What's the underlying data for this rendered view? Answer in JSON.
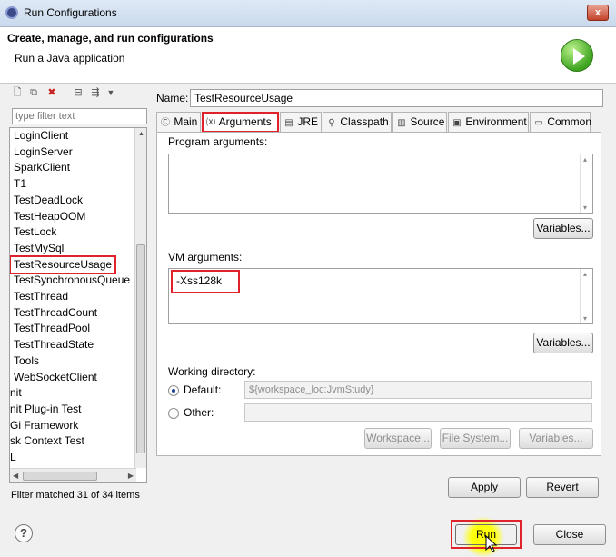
{
  "window": {
    "title": "Run Configurations",
    "close_glyph": "x"
  },
  "header": {
    "title": "Create, manage, and run configurations",
    "subtitle": "Run a Java application",
    "icon": "run-icon"
  },
  "left": {
    "toolbar_icons": [
      "new-launch-config-icon",
      "duplicate-icon",
      "delete-icon",
      "collapse-all-icon",
      "filter-icon",
      "chevron-down-icon"
    ],
    "filter_placeholder": "type filter text",
    "items": [
      "LoginClient",
      "LoginServer",
      "SparkClient",
      "T1",
      "TestDeadLock",
      "TestHeapOOM",
      "TestLock",
      "TestMySql",
      "TestResourceUsage",
      "TestSynchronousQueue",
      "TestThread",
      "TestThreadCount",
      "TestThreadPool",
      "TestThreadState",
      "Tools",
      "WebSocketClient",
      "nit",
      "nit Plug-in Test",
      "Gi Framework",
      "sk Context Test",
      "L"
    ],
    "selected_item": "TestResourceUsage",
    "filter_status": "Filter matched 31 of 34 items"
  },
  "right": {
    "name_label": "Name:",
    "name_value": "TestResourceUsage",
    "tabs": [
      {
        "label": "Main",
        "icon": "main-tab-icon"
      },
      {
        "label": "Arguments",
        "icon": "arguments-tab-icon"
      },
      {
        "label": "JRE",
        "icon": "jre-tab-icon"
      },
      {
        "label": "Classpath",
        "icon": "classpath-tab-icon"
      },
      {
        "label": "Source",
        "icon": "source-tab-icon"
      },
      {
        "label": "Environment",
        "icon": "environment-tab-icon"
      },
      {
        "label": "Common",
        "icon": "common-tab-icon"
      }
    ],
    "active_tab": "Arguments",
    "program_args_label": "Program arguments:",
    "program_args_value": "",
    "variables_label": "Variables...",
    "vm_args_label": "VM arguments:",
    "vm_args_value": "-Xss128k",
    "working_dir_label": "Working directory:",
    "default_label": "Default:",
    "default_value": "${workspace_loc:JvmStudy}",
    "other_label": "Other:",
    "other_value": "",
    "workspace_label": "Workspace...",
    "filesystem_label": "File System...",
    "variables2_label": "Variables...",
    "apply_label": "Apply",
    "revert_label": "Revert"
  },
  "footer": {
    "help_glyph": "?",
    "run_label": "Run",
    "close_label": "Close"
  },
  "colors": {
    "highlight": "#e0232a",
    "titlebar": "#c9d9ec"
  }
}
